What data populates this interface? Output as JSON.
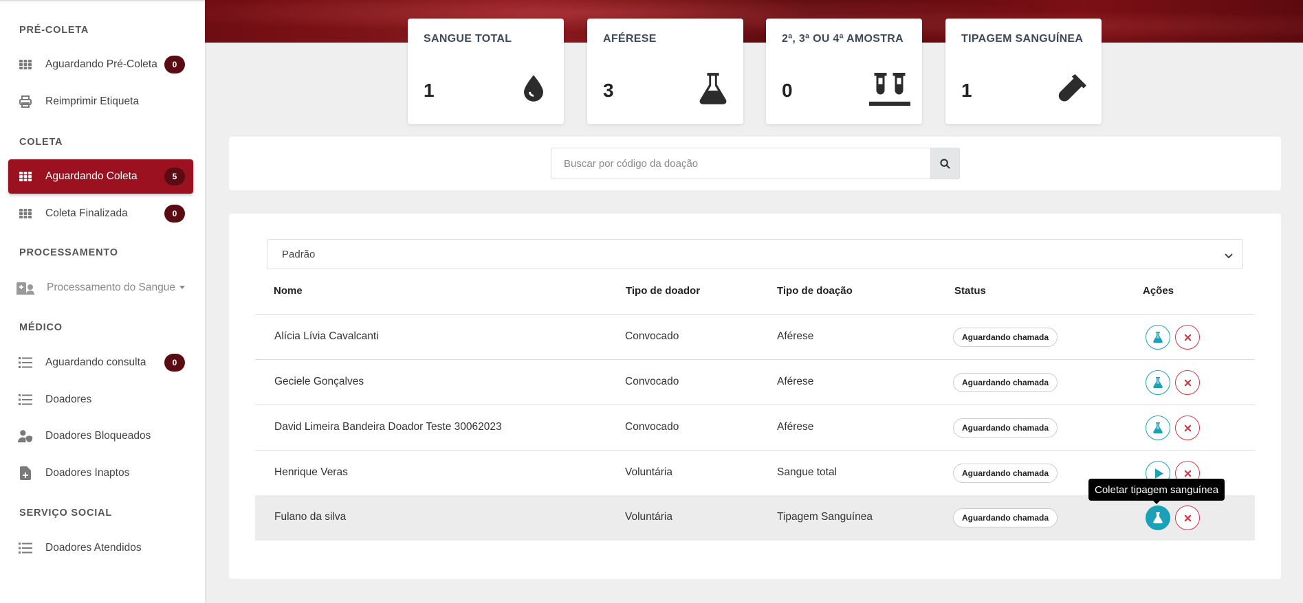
{
  "sidebar": {
    "sections": [
      {
        "title": "PRÉ-COLETA"
      },
      {
        "title": "COLETA"
      },
      {
        "title": "PROCESSAMENTO"
      },
      {
        "title": "MÉDICO"
      },
      {
        "title": "SERVIÇO SOCIAL"
      }
    ],
    "items": [
      {
        "label": "Aguardando Pré-Coleta",
        "badge": "0",
        "icon": "grid-icon"
      },
      {
        "label": "Reimprimir Etiqueta",
        "icon": "printer-icon"
      },
      {
        "label": "Aguardando Coleta",
        "badge": "5",
        "icon": "grid-icon"
      },
      {
        "label": "Coleta Finalizada",
        "badge": "0",
        "icon": "grid-icon"
      },
      {
        "label": "Processamento do Sangue",
        "icon": "hospital-user-icon"
      },
      {
        "label": "Aguardando consulta",
        "badge": "0",
        "icon": "list-icon"
      },
      {
        "label": "Doadores",
        "icon": "list-icon"
      },
      {
        "label": "Doadores Bloqueados",
        "icon": "user-shield-icon"
      },
      {
        "label": "Doadores Inaptos",
        "icon": "file-medical-icon"
      },
      {
        "label": "Doadores Atendidos",
        "icon": "list-icon"
      }
    ]
  },
  "stats": [
    {
      "title": "SANGUE TOTAL",
      "value": "1",
      "icon": "droplet-icon"
    },
    {
      "title": "AFÉRESE",
      "value": "3",
      "icon": "flask-icon"
    },
    {
      "title": "2ª, 3ª OU 4ª AMOSTRA",
      "value": "0",
      "icon": "vials-icon"
    },
    {
      "title": "TIPAGEM SANGUÍNEA",
      "value": "1",
      "icon": "syringe-icon"
    }
  ],
  "search": {
    "placeholder": "Buscar por código da doação",
    "value": ""
  },
  "filter": {
    "selected": "Padrão"
  },
  "table": {
    "headers": {
      "nome": "Nome",
      "tipo_doador": "Tipo de doador",
      "tipo_doacao": "Tipo de doação",
      "status": "Status",
      "acoes": "Ações"
    },
    "rows": [
      {
        "nome": "Alícia Lívia Cavalcanti",
        "tipo_doador": "Convocado",
        "tipo_doacao": "Aférese",
        "status": "Aguardando chamada",
        "action": "flask-icon"
      },
      {
        "nome": "Geciele Gonçalves",
        "tipo_doador": "Convocado",
        "tipo_doacao": "Aférese",
        "status": "Aguardando chamada",
        "action": "flask-icon"
      },
      {
        "nome": "David Limeira Bandeira Doador Teste 30062023",
        "tipo_doador": "Convocado",
        "tipo_doacao": "Aférese",
        "status": "Aguardando chamada",
        "action": "flask-icon"
      },
      {
        "nome": "Henrique Veras",
        "tipo_doador": "Voluntária",
        "tipo_doacao": "Sangue total",
        "status": "Aguardando chamada",
        "action": "play-icon"
      },
      {
        "nome": "Fulano da silva",
        "tipo_doador": "Voluntária",
        "tipo_doacao": "Tipagem Sanguínea",
        "status": "Aguardando chamada",
        "action": "flask-icon"
      }
    ]
  },
  "tooltip": {
    "text": "Coletar tipagem sanguínea"
  },
  "colors": {
    "brand": "#9b1120",
    "badge": "#5b0b12",
    "action_primary": "#1aa1b8",
    "action_danger": "#dc3545"
  }
}
